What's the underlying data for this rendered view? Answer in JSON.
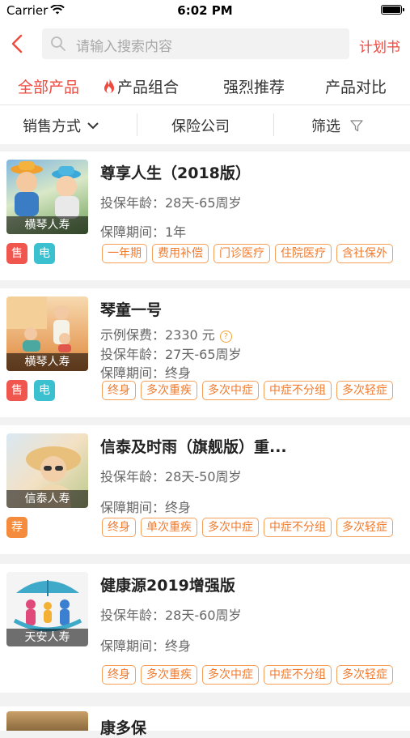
{
  "status_bar": {
    "carrier": "Carrier",
    "time": "6:02 PM"
  },
  "nav": {
    "search_placeholder": "请输入搜索内容",
    "plan_label": "计划书"
  },
  "tabs": [
    {
      "label": "全部产品",
      "active": true
    },
    {
      "label": "产品组合",
      "icon": "fire-icon"
    },
    {
      "label": "强烈推荐"
    },
    {
      "label": "产品对比"
    }
  ],
  "filters": [
    {
      "label": "销售方式",
      "icon": "chevron-down-icon"
    },
    {
      "label": "保险公司"
    },
    {
      "label": "筛选",
      "icon": "funnel-icon"
    }
  ],
  "products": [
    {
      "title": "尊享人生（2018版）",
      "company": "横琴人寿",
      "lines": [
        "投保年龄：28天-65周岁",
        "保障期间：1年"
      ],
      "badges": [
        {
          "text": "售",
          "color": "#f0554e"
        },
        {
          "text": "电",
          "color": "#3ac0cf"
        }
      ],
      "tags": [
        "一年期",
        "费用补偿",
        "门诊医疗",
        "住院医疗",
        "含社保外"
      ]
    },
    {
      "title": "琴童一号",
      "company": "横琴人寿",
      "premium_label": "示例保费：2330 元",
      "lines": [
        "投保年龄：27天-65周岁",
        "保障期间：终身"
      ],
      "badges": [
        {
          "text": "售",
          "color": "#f0554e"
        },
        {
          "text": "电",
          "color": "#3ac0cf"
        }
      ],
      "tags": [
        "终身",
        "多次重疾",
        "多次中症",
        "中症不分组",
        "多次轻症"
      ]
    },
    {
      "title": "信泰及时雨（旗舰版）重...",
      "company": "信泰人寿",
      "lines": [
        "投保年龄：28天-50周岁",
        "保障期间：终身"
      ],
      "badges": [
        {
          "text": "荐",
          "color": "#f58b3c"
        }
      ],
      "tags": [
        "终身",
        "单次重疾",
        "多次中症",
        "中症不分组",
        "多次轻症"
      ]
    },
    {
      "title": "健康源2019增强版",
      "company": "天安人寿",
      "lines": [
        "投保年龄：28天-60周岁",
        "保障期间：终身"
      ],
      "badges": [],
      "tags": [
        "终身",
        "多次重疾",
        "多次中症",
        "中症不分组",
        "多次轻症"
      ]
    }
  ],
  "partial_product": {
    "title": "康多保"
  },
  "colors": {
    "accent": "#f0493e",
    "tag": "#f07b2e"
  }
}
